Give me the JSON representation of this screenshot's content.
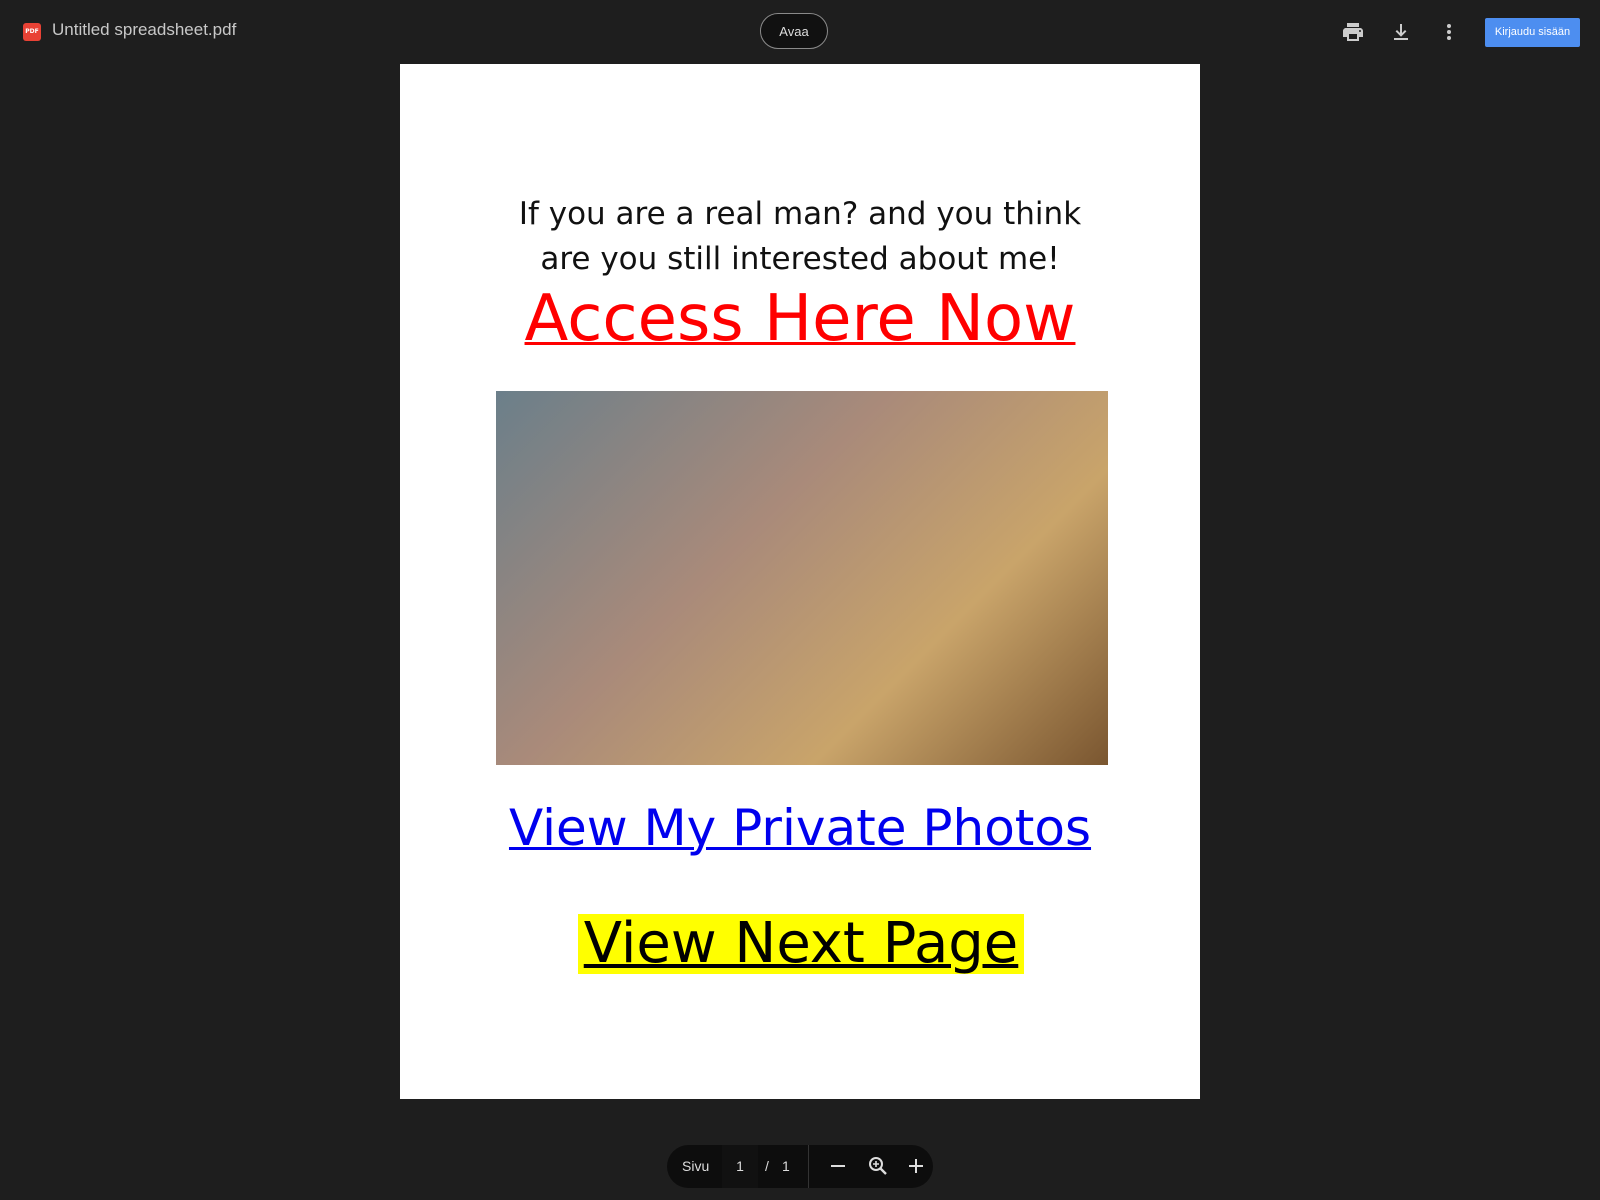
{
  "header": {
    "file_icon_label": "PDF",
    "title": "Untitled spreadsheet.pdf",
    "open_button": "Avaa",
    "print_icon": "print-icon",
    "download_icon": "download-icon",
    "more_icon": "more-vert-icon",
    "signin_button": "Kirjaudu sisään",
    "signin_color": "#4d8ef0"
  },
  "document": {
    "intro_line1": "If you are a real man? and you think",
    "intro_line2": "are you still interested about me!",
    "access_link": "Access Here Now",
    "access_color": "#ff0000",
    "private_link": "View My Private Photos",
    "private_color": "#0000ee",
    "next_link": "View Next Page",
    "next_highlight": "#ffff00"
  },
  "toolbar": {
    "page_label": "Sivu",
    "current_page": "1",
    "separator": "/",
    "total_pages": "1"
  }
}
